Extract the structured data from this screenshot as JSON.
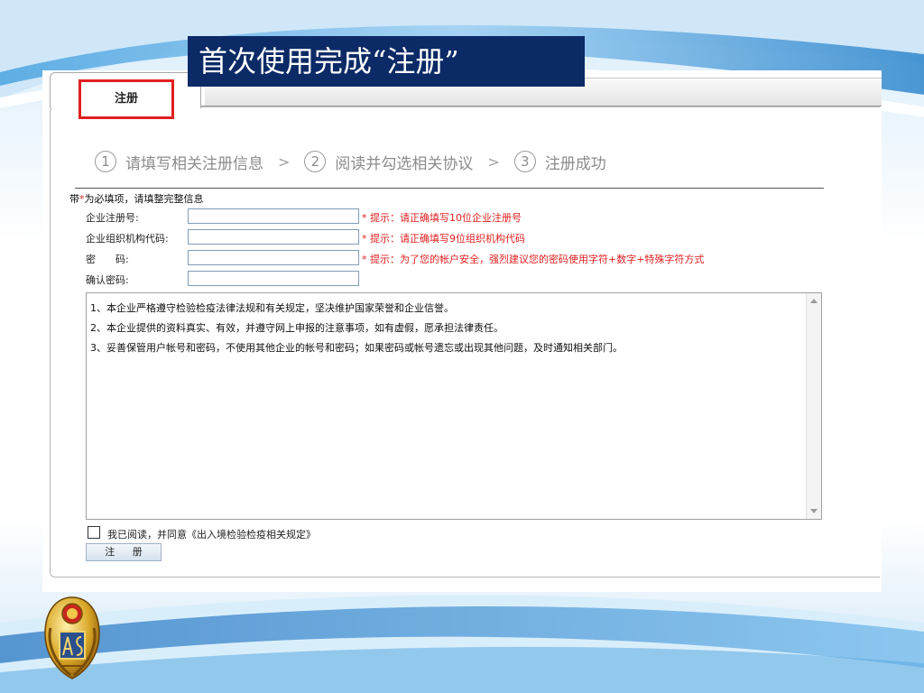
{
  "slide": {
    "title": "首次使用完成“注册”"
  },
  "tabs": {
    "register_label": "注册"
  },
  "steps": [
    {
      "num": "1",
      "label": "请填写相关注册信息"
    },
    {
      "num": "2",
      "label": "阅读并勾选相关协议"
    },
    {
      "num": "3",
      "label": "注册成功"
    }
  ],
  "step_separator": ">",
  "form": {
    "required_prefix": "带",
    "required_star": "*",
    "required_suffix": "为必填项，请填整完整信息",
    "fields": [
      {
        "label": "企业注册号:",
        "value": "",
        "hint": "* 提示：请正确填写10位企业注册号"
      },
      {
        "label": "企业组织机构代码:",
        "value": "",
        "hint": "* 提示：请正确填写9位组织机构代码"
      },
      {
        "label": "密　　码:",
        "value": "",
        "hint": "* 提示：为了您的帐户安全，强烈建议您的密码使用字符+数字+特殊字符方式"
      },
      {
        "label": "确认密码:",
        "value": "",
        "hint": ""
      }
    ]
  },
  "agreement": {
    "lines": [
      "1、本企业严格遵守检验检疫法律法规和有关规定，坚决维护国家荣誉和企业信誉。",
      "2、本企业提供的资料真实、有效，并遵守网上申报的注意事项，如有虚假，愿承担法律责任。",
      "3、妥善保管用户帐号和密码，不使用其他企业的帐号和密码；如果密码或帐号遗忘或出现其他问题，及时通知相关部门。"
    ]
  },
  "consent": {
    "label": "我已阅读，并同意《出入境检验检疫相关规定》",
    "checked": false
  },
  "buttons": {
    "register": "注 册"
  },
  "colors": {
    "title_bg": "#0b2a66",
    "hint_red": "#e02020",
    "tab_highlight": "#e02020"
  },
  "icons": {
    "emblem": "ciq-emblem-icon"
  }
}
